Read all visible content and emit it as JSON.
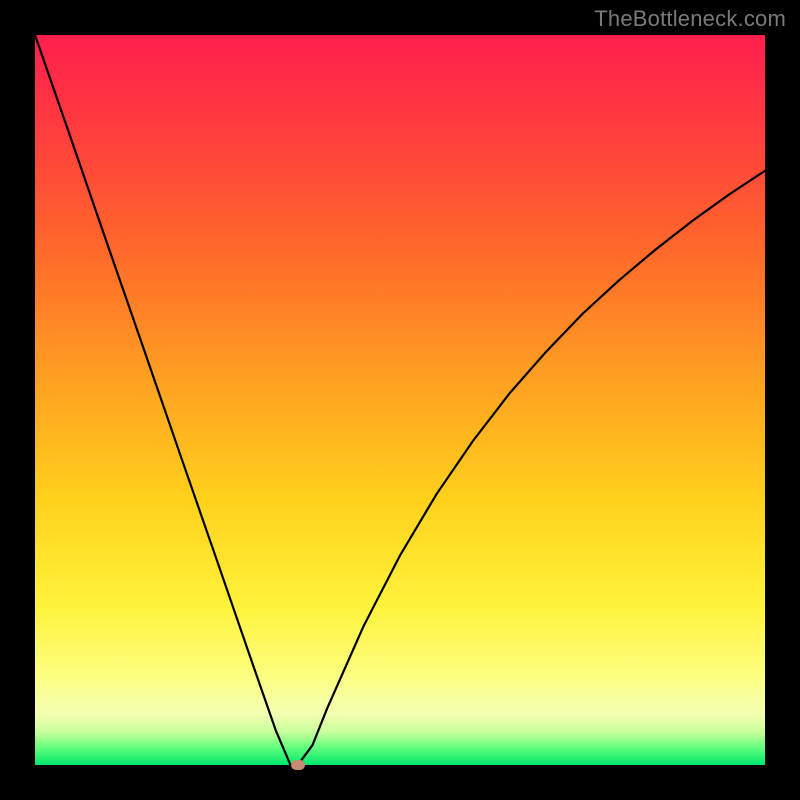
{
  "watermark": "TheBottleneck.com",
  "colors": {
    "frame": "#000000",
    "gradient_top": "#ff1f4d",
    "gradient_bottom": "#00e86c",
    "curve": "#000000",
    "marker": "#c58b74"
  },
  "chart_data": {
    "type": "line",
    "title": "",
    "xlabel": "",
    "ylabel": "",
    "xlim": [
      0,
      100
    ],
    "ylim": [
      0,
      100
    ],
    "x": [
      0,
      5,
      10,
      15,
      20,
      25,
      30,
      33,
      35,
      36,
      38,
      40,
      45,
      50,
      55,
      60,
      65,
      70,
      75,
      80,
      85,
      90,
      95,
      100
    ],
    "values": [
      100,
      85.6,
      71.1,
      56.7,
      42.2,
      27.8,
      13.3,
      4.7,
      0.0,
      0.0,
      2.7,
      7.7,
      19.0,
      28.7,
      37.1,
      44.4,
      50.9,
      56.6,
      61.8,
      66.4,
      70.6,
      74.5,
      78.1,
      81.4
    ],
    "marker": {
      "x": 36,
      "y": 0
    },
    "notes": "V-shaped bottleneck curve; vertex at x≈36. Left branch linear from (0,100) to (35,0); right branch sqrt-like rise toward (100,~81)."
  }
}
